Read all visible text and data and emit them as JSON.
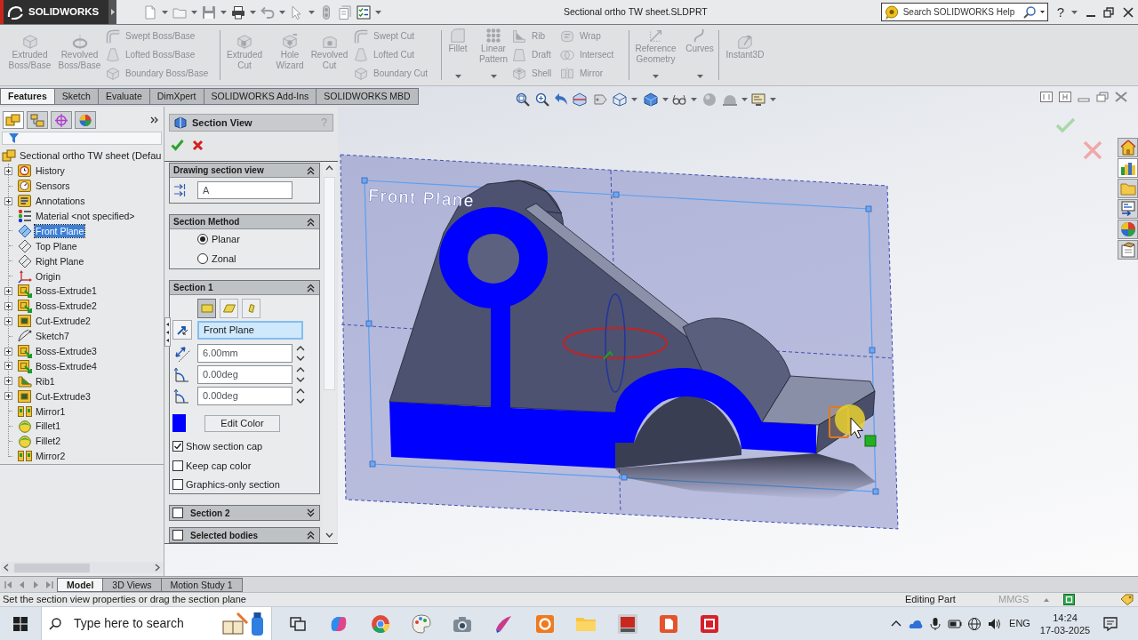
{
  "title_bar": {
    "logo_text": "SOLIDWORKS",
    "title": "Sectional ortho TW sheet.SLDPRT",
    "search": {
      "placeholder": "Search SOLIDWORKS Help"
    },
    "help_button": "?"
  },
  "ribbon": {
    "groups": [
      {
        "columns": [
          {
            "kind": "large",
            "label": "Extruded Boss/Base",
            "menu": false,
            "disabled": true
          },
          {
            "kind": "large",
            "label": "Revolved Boss/Base",
            "menu": false,
            "disabled": true
          },
          {
            "kind": "stack",
            "items": [
              {
                "label": "Swept Boss/Base",
                "disabled": true
              },
              {
                "label": "Lofted Boss/Base",
                "disabled": true
              },
              {
                "label": "Boundary Boss/Base",
                "disabled": true
              }
            ]
          }
        ]
      },
      {
        "columns": [
          {
            "kind": "large",
            "label": "Extruded Cut",
            "menu": false,
            "disabled": true
          },
          {
            "kind": "large",
            "label": "Hole Wizard",
            "menu": false,
            "disabled": true
          },
          {
            "kind": "large",
            "label": "Revolved Cut",
            "menu": false,
            "disabled": true
          },
          {
            "kind": "stack",
            "items": [
              {
                "label": "Swept Cut",
                "disabled": true
              },
              {
                "label": "Lofted Cut",
                "disabled": true
              },
              {
                "label": "Boundary Cut",
                "disabled": true
              }
            ]
          }
        ]
      },
      {
        "columns": [
          {
            "kind": "large",
            "label": "Fillet",
            "menu": true,
            "disabled": true
          },
          {
            "kind": "large",
            "label": "Linear Pattern",
            "menu": true,
            "disabled": true
          },
          {
            "kind": "stack",
            "items": [
              {
                "label": "Rib",
                "disabled": true
              },
              {
                "label": "Draft",
                "disabled": true
              },
              {
                "label": "Shell",
                "disabled": true
              }
            ]
          },
          {
            "kind": "stack",
            "items": [
              {
                "label": "Wrap",
                "disabled": true
              },
              {
                "label": "Intersect",
                "disabled": true
              },
              {
                "label": "Mirror",
                "disabled": true
              }
            ]
          }
        ]
      },
      {
        "columns": [
          {
            "kind": "large",
            "label": "Reference Geometry",
            "menu": true,
            "disabled": true
          },
          {
            "kind": "large",
            "label": "Curves",
            "menu": true,
            "disabled": true
          }
        ]
      },
      {
        "columns": [
          {
            "kind": "large",
            "label": "Instant3D",
            "menu": false,
            "disabled": true
          }
        ]
      }
    ]
  },
  "command_tabs": [
    {
      "label": "Features",
      "selected": true
    },
    {
      "label": "Sketch",
      "selected": false
    },
    {
      "label": "Evaluate",
      "selected": false
    },
    {
      "label": "DimXpert",
      "selected": false
    },
    {
      "label": "SOLIDWORKS Add-Ins",
      "selected": false
    },
    {
      "label": "SOLIDWORKS MBD",
      "selected": false
    }
  ],
  "feature_tree": {
    "manager_tabs": [
      {
        "selected": true
      },
      {
        "selected": false
      },
      {
        "selected": false
      },
      {
        "selected": false
      }
    ],
    "root": {
      "label": "Sectional ortho TW sheet (Defau",
      "children": [
        {
          "label": "History",
          "kind": "history",
          "expandable": true,
          "selected": false
        },
        {
          "label": "Sensors",
          "kind": "sensors",
          "expandable": false,
          "selected": false
        },
        {
          "label": "Annotations",
          "kind": "annotations",
          "expandable": true,
          "selected": false
        },
        {
          "label": "Material <not specified>",
          "kind": "material",
          "expandable": false,
          "selected": false
        },
        {
          "label": "Front Plane",
          "kind": "plane",
          "expandable": false,
          "selected": true
        },
        {
          "label": "Top Plane",
          "kind": "plane",
          "expandable": false,
          "selected": false
        },
        {
          "label": "Right Plane",
          "kind": "plane",
          "expandable": false,
          "selected": false
        },
        {
          "label": "Origin",
          "kind": "origin",
          "expandable": false,
          "selected": false
        },
        {
          "label": "Boss-Extrude1",
          "kind": "boss",
          "expandable": true,
          "selected": false
        },
        {
          "label": "Boss-Extrude2",
          "kind": "boss",
          "expandable": true,
          "selected": false
        },
        {
          "label": "Cut-Extrude2",
          "kind": "cut",
          "expandable": true,
          "selected": false
        },
        {
          "label": "Sketch7",
          "kind": "sketch",
          "expandable": false,
          "selected": false
        },
        {
          "label": "Boss-Extrude3",
          "kind": "boss",
          "expandable": true,
          "selected": false
        },
        {
          "label": "Boss-Extrude4",
          "kind": "boss",
          "expandable": true,
          "selected": false
        },
        {
          "label": "Rib1",
          "kind": "rib",
          "expandable": true,
          "selected": false
        },
        {
          "label": "Cut-Extrude3",
          "kind": "cut",
          "expandable": true,
          "selected": false
        },
        {
          "label": "Mirror1",
          "kind": "mirror",
          "expandable": false,
          "selected": false
        },
        {
          "label": "Fillet1",
          "kind": "fillet",
          "expandable": false,
          "selected": false
        },
        {
          "label": "Fillet2",
          "kind": "fillet",
          "expandable": false,
          "selected": false
        },
        {
          "label": "Mirror2",
          "kind": "mirror",
          "expandable": false,
          "selected": false
        }
      ]
    }
  },
  "property_manager": {
    "title": "Section View",
    "help": "?",
    "groups": [
      {
        "kind": "label_field",
        "title": "Drawing section view",
        "expanded": true,
        "value": "A"
      },
      {
        "kind": "radios",
        "title": "Section Method",
        "expanded": true,
        "options": [
          {
            "label": "Planar",
            "selected": true
          },
          {
            "label": "Zonal",
            "selected": false
          }
        ]
      },
      {
        "kind": "section",
        "title": "Section 1",
        "expanded": true,
        "plane_buttons": [
          {
            "selected": true
          },
          {
            "selected": false
          },
          {
            "selected": false
          }
        ],
        "reference": "Front Plane",
        "offset": "6.00mm",
        "angle_x": "0.00deg",
        "angle_y": "0.00deg",
        "color": "#0000ff",
        "color_button": "Edit Color",
        "options": [
          {
            "label": "Show section cap",
            "checked": true
          },
          {
            "label": "Keep cap color",
            "checked": false
          },
          {
            "label": "Graphics-only section",
            "checked": false
          }
        ]
      },
      {
        "kind": "check_header",
        "title": "Section 2",
        "checked": false,
        "expanded": false
      },
      {
        "kind": "check_header",
        "title": "Selected bodies",
        "checked": false,
        "expanded": true
      }
    ]
  },
  "viewport": {
    "plane_label": "Front Plane",
    "task_pane_tabs": [
      {
        "selected": false
      },
      {
        "selected": true
      },
      {
        "selected": false
      },
      {
        "selected": false
      },
      {
        "selected": false
      },
      {
        "selected": false
      }
    ]
  },
  "bottom_tabs": [
    {
      "label": "Model",
      "selected": true
    },
    {
      "label": "3D Views",
      "selected": false
    },
    {
      "label": "Motion Study 1",
      "selected": false
    }
  ],
  "status_bar": {
    "message": "Set the section view properties or drag the section plane",
    "mode": "Editing Part",
    "units": "MMGS"
  },
  "taskbar": {
    "search_placeholder": "Type here to search",
    "language": "ENG",
    "time": "14:24",
    "date": "17-03-2025"
  }
}
